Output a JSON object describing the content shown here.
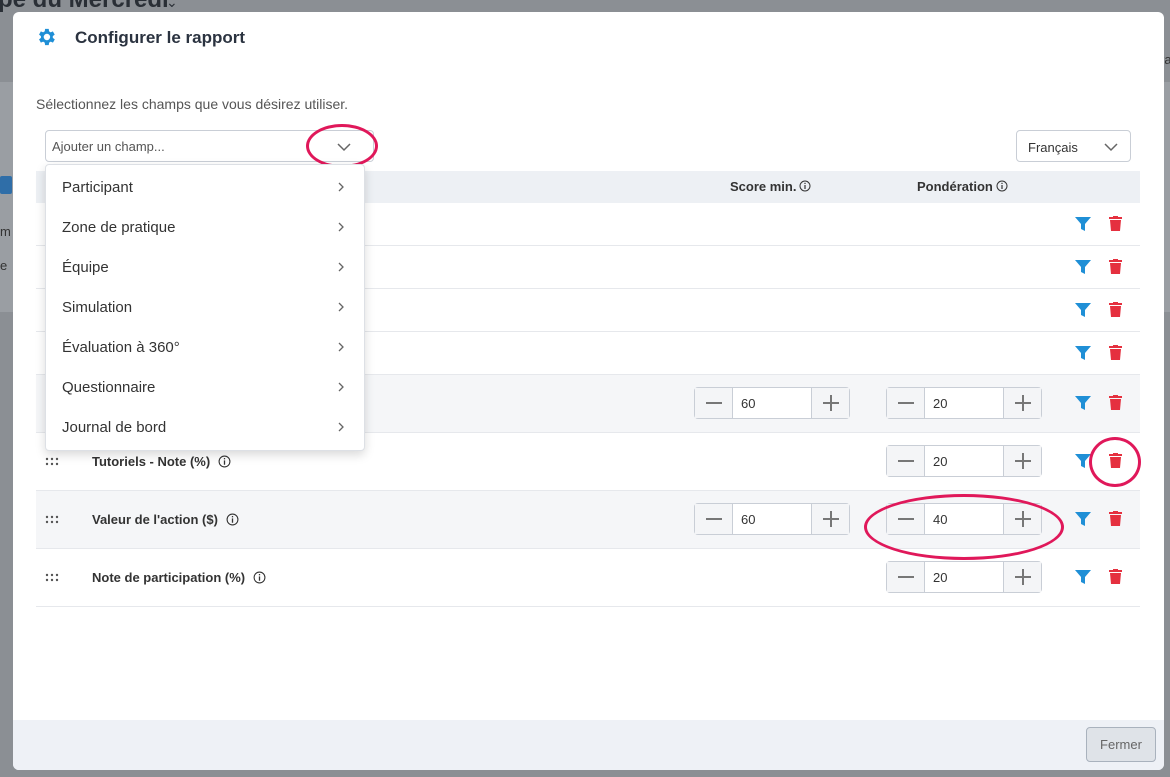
{
  "background": {
    "page_title": "pe du Mercredi",
    "text_a": "m",
    "text_b": "e",
    "text_c": "ra"
  },
  "modal": {
    "title": "Configurer le rapport",
    "instructions": "Sélectionnez les champs que vous désirez utiliser.",
    "add_field_placeholder": "Ajouter un champ...",
    "language": "Français",
    "columns": {
      "score_min": "Score min.",
      "ponderation": "Pondération"
    },
    "dropdown_items": [
      "Participant",
      "Zone de pratique",
      "Équipe",
      "Simulation",
      "Évaluation à 360°",
      "Questionnaire",
      "Journal de bord"
    ],
    "rows": [
      {
        "label": "",
        "score_min": null,
        "ponderation": null
      },
      {
        "label": "",
        "score_min": null,
        "ponderation": null
      },
      {
        "label": "",
        "score_min": null,
        "ponderation": null
      },
      {
        "label": "",
        "score_min": null,
        "ponderation": null
      },
      {
        "label": "",
        "score_min": "60",
        "ponderation": "20"
      },
      {
        "label": "Tutoriels - Note (%)",
        "score_min": null,
        "ponderation": "20"
      },
      {
        "label": "Valeur de l'action ($)",
        "score_min": "60",
        "ponderation": "40"
      },
      {
        "label": "Note de participation (%)",
        "score_min": null,
        "ponderation": "20"
      }
    ],
    "close_label": "Fermer"
  },
  "colors": {
    "accent_blue": "#1f8fd6",
    "delete_red": "#e5303f",
    "highlight": "#e0185a"
  }
}
